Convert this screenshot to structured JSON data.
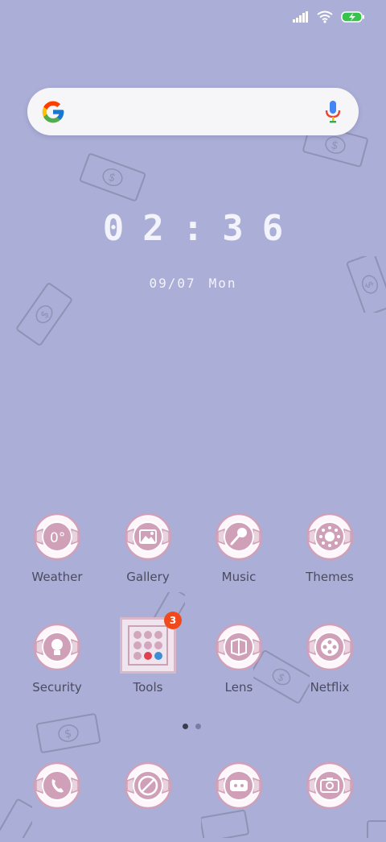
{
  "status_bar": {
    "signal_icon": "signal-icon",
    "wifi_icon": "wifi-icon",
    "battery_icon": "battery-charging-icon"
  },
  "search": {
    "placeholder": "",
    "logo_icon": "google-logo-icon",
    "mic_icon": "mic-icon"
  },
  "clock": {
    "time": "02:36",
    "date": "09/07",
    "day": "Mon"
  },
  "apps_row1": [
    {
      "label": "Weather",
      "icon": "weather-icon"
    },
    {
      "label": "Gallery",
      "icon": "gallery-icon"
    },
    {
      "label": "Music",
      "icon": "music-icon"
    },
    {
      "label": "Themes",
      "icon": "themes-icon"
    }
  ],
  "apps_row2": [
    {
      "label": "Security",
      "icon": "security-icon"
    },
    {
      "label": "Tools",
      "icon": "folder-icon",
      "badge": "3"
    },
    {
      "label": "Lens",
      "icon": "lens-icon"
    },
    {
      "label": "Netflix",
      "icon": "netflix-icon"
    }
  ],
  "dock": [
    {
      "icon": "phone-icon"
    },
    {
      "icon": "browser-icon"
    },
    {
      "icon": "messages-icon"
    },
    {
      "icon": "camera-icon"
    }
  ],
  "page_indicator": {
    "current": 1,
    "total": 2
  },
  "colors": {
    "background": "#abaed6",
    "icon_pink": "#cfa0b8",
    "badge_orange": "#f04a1c",
    "label": "#4b4b60"
  }
}
